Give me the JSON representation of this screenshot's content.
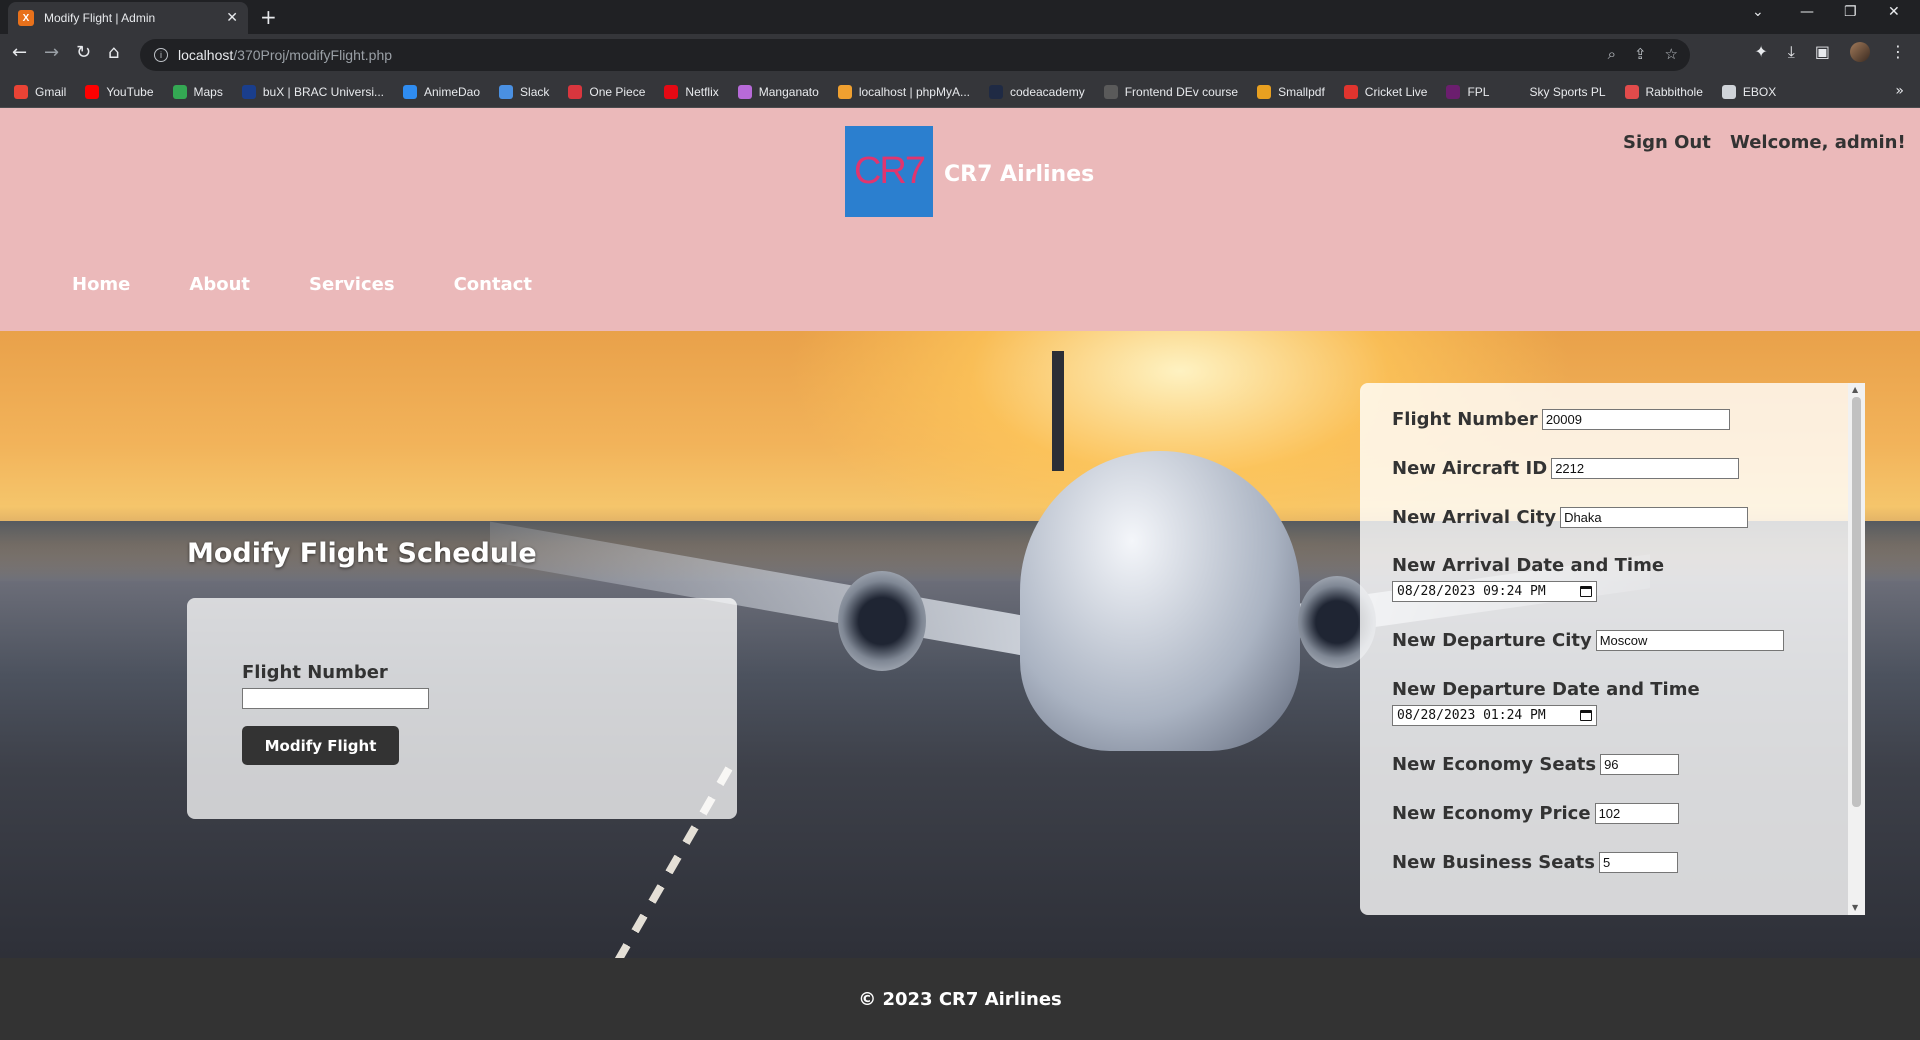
{
  "browser": {
    "tab_title": "Modify Flight | Admin",
    "url_host": "localhost",
    "url_path": "/370Proj/modifyFlight.php",
    "bookmarks": [
      {
        "label": "Gmail",
        "color": "#ea4335"
      },
      {
        "label": "YouTube",
        "color": "#ff0000"
      },
      {
        "label": "Maps",
        "color": "#34a853"
      },
      {
        "label": "buX | BRAC Universi...",
        "color": "#1a3e8c"
      },
      {
        "label": "AnimeDao",
        "color": "#2f8cf0"
      },
      {
        "label": "Slack",
        "color": "#4a90e2"
      },
      {
        "label": "One Piece",
        "color": "#d9363e"
      },
      {
        "label": "Netflix",
        "color": "#e50914"
      },
      {
        "label": "Manganato",
        "color": "#b76ad8"
      },
      {
        "label": "localhost | phpMyA...",
        "color": "#f0a030"
      },
      {
        "label": "codeacademy",
        "color": "#1f2a44"
      },
      {
        "label": "Frontend DEv course",
        "color": "#5a5a5a"
      },
      {
        "label": "Smallpdf",
        "color": "#e8a020"
      },
      {
        "label": "Cricket Live",
        "color": "#e0342e"
      },
      {
        "label": "FPL",
        "color": "#6b1e6e"
      },
      {
        "label": "Sky Sports PL",
        "color": "#35363a"
      },
      {
        "label": "Rabbithole",
        "color": "#e24b4b"
      },
      {
        "label": "EBOX",
        "color": "#cfd3d8"
      }
    ]
  },
  "header": {
    "logo_text": "CR7",
    "brand": "CR7 Airlines",
    "sign_out": "Sign Out",
    "welcome": "Welcome, admin!",
    "nav": [
      "Home",
      "About",
      "Services",
      "Contact"
    ]
  },
  "search_form": {
    "title": "Modify Flight Schedule",
    "label": "Flight Number",
    "value": "",
    "button": "Modify Flight"
  },
  "edit_form": {
    "flight_number_label": "Flight Number",
    "flight_number": "20009",
    "aircraft_label": "New Aircraft ID",
    "aircraft": "2212",
    "arrival_city_label": "New Arrival City",
    "arrival_city": "Dhaka",
    "arrival_dt_label": "New Arrival Date and Time",
    "arrival_dt": "08/28/2023  09:24  PM",
    "departure_city_label": "New Departure City",
    "departure_city": "Moscow",
    "departure_dt_label": "New Departure Date and Time",
    "departure_dt": "08/28/2023  01:24  PM",
    "economy_seats_label": "New Economy Seats",
    "economy_seats": "96",
    "economy_price_label": "New Economy Price",
    "economy_price": "102",
    "business_seats_label": "New Business Seats",
    "business_seats": "5"
  },
  "footer": {
    "text": "© 2023 CR7 Airlines"
  }
}
